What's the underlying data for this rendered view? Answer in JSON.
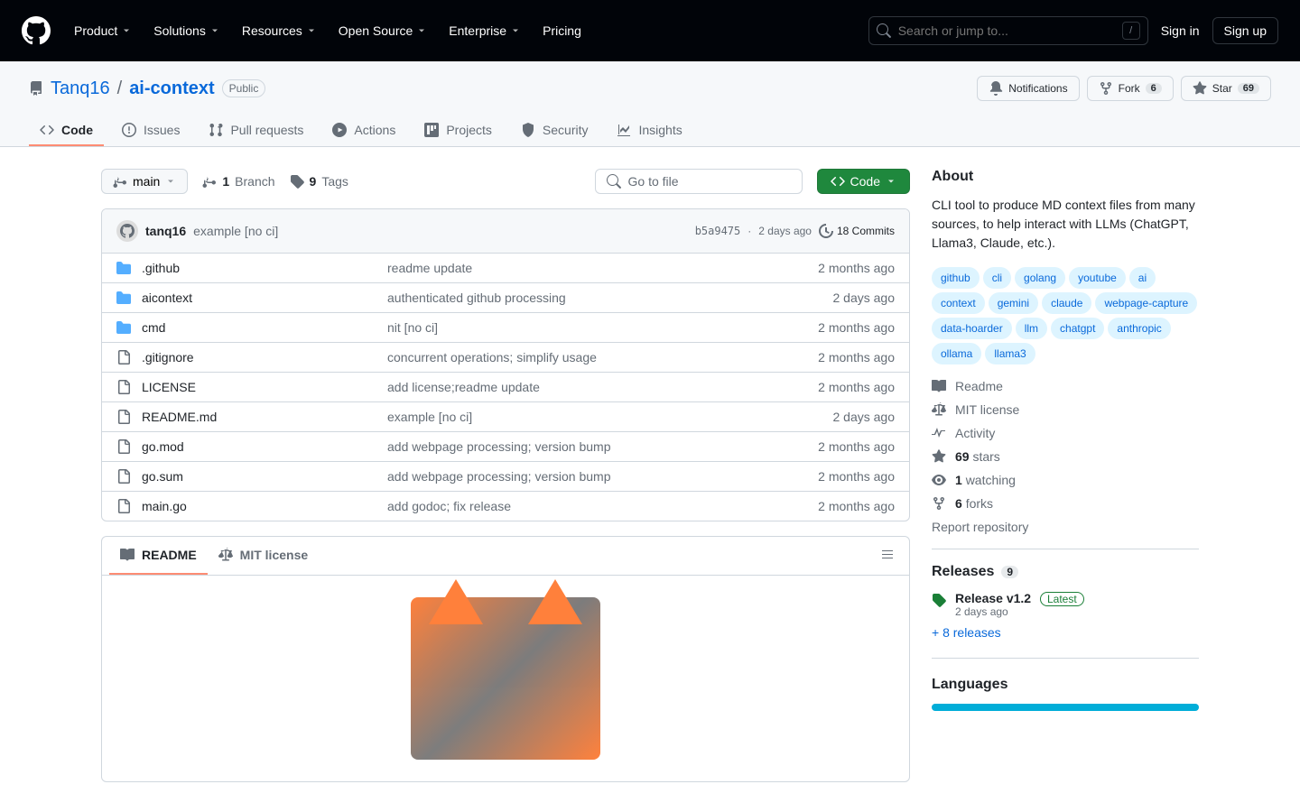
{
  "topbar": {
    "nav": [
      "Product",
      "Solutions",
      "Resources",
      "Open Source",
      "Enterprise",
      "Pricing"
    ],
    "search_placeholder": "Search or jump to...",
    "kbd": "/",
    "signin": "Sign in",
    "signup": "Sign up"
  },
  "repo": {
    "owner": "Tanq16",
    "name": "ai-context",
    "visibility": "Public",
    "actions": {
      "notifications": "Notifications",
      "fork": "Fork",
      "fork_count": "6",
      "star": "Star",
      "star_count": "69"
    }
  },
  "tabs": [
    "Code",
    "Issues",
    "Pull requests",
    "Actions",
    "Projects",
    "Security",
    "Insights"
  ],
  "toolbar": {
    "branch": "main",
    "branches_count": "1",
    "branches_label": "Branch",
    "tags_count": "9",
    "tags_label": "Tags",
    "go_to_file": "Go to file",
    "code_btn": "Code"
  },
  "commit": {
    "author": "tanq16",
    "message": "example [no ci]",
    "sha": "b5a9475",
    "time": "2 days ago",
    "commits_label": "18 Commits"
  },
  "files": [
    {
      "type": "dir",
      "name": ".github",
      "msg": "readme update",
      "time": "2 months ago"
    },
    {
      "type": "dir",
      "name": "aicontext",
      "msg": "authenticated github processing",
      "time": "2 days ago"
    },
    {
      "type": "dir",
      "name": "cmd",
      "msg": "nit [no ci]",
      "time": "2 months ago"
    },
    {
      "type": "file",
      "name": ".gitignore",
      "msg": "concurrent operations; simplify usage",
      "time": "2 months ago"
    },
    {
      "type": "file",
      "name": "LICENSE",
      "msg": "add license;readme update",
      "time": "2 months ago"
    },
    {
      "type": "file",
      "name": "README.md",
      "msg": "example [no ci]",
      "time": "2 days ago"
    },
    {
      "type": "file",
      "name": "go.mod",
      "msg": "add webpage processing; version bump",
      "time": "2 months ago"
    },
    {
      "type": "file",
      "name": "go.sum",
      "msg": "add webpage processing; version bump",
      "time": "2 months ago"
    },
    {
      "type": "file",
      "name": "main.go",
      "msg": "add godoc; fix release",
      "time": "2 months ago"
    }
  ],
  "readme_tabs": {
    "readme": "README",
    "license": "MIT license"
  },
  "about": {
    "heading": "About",
    "description": "CLI tool to produce MD context files from many sources, to help interact with LLMs (ChatGPT, Llama3, Claude, etc.).",
    "topics": [
      "github",
      "cli",
      "golang",
      "youtube",
      "ai",
      "context",
      "gemini",
      "claude",
      "webpage-capture",
      "data-hoarder",
      "llm",
      "chatgpt",
      "anthropic",
      "ollama",
      "llama3"
    ],
    "links": {
      "readme": "Readme",
      "license": "MIT license",
      "activity": "Activity",
      "stars_count": "69",
      "stars_label": "stars",
      "watching_count": "1",
      "watching_label": "watching",
      "forks_count": "6",
      "forks_label": "forks",
      "report": "Report repository"
    }
  },
  "releases": {
    "heading": "Releases",
    "count": "9",
    "latest_title": "Release v1.2",
    "latest_badge": "Latest",
    "latest_time": "2 days ago",
    "more": "+ 8 releases"
  },
  "languages": {
    "heading": "Languages"
  }
}
